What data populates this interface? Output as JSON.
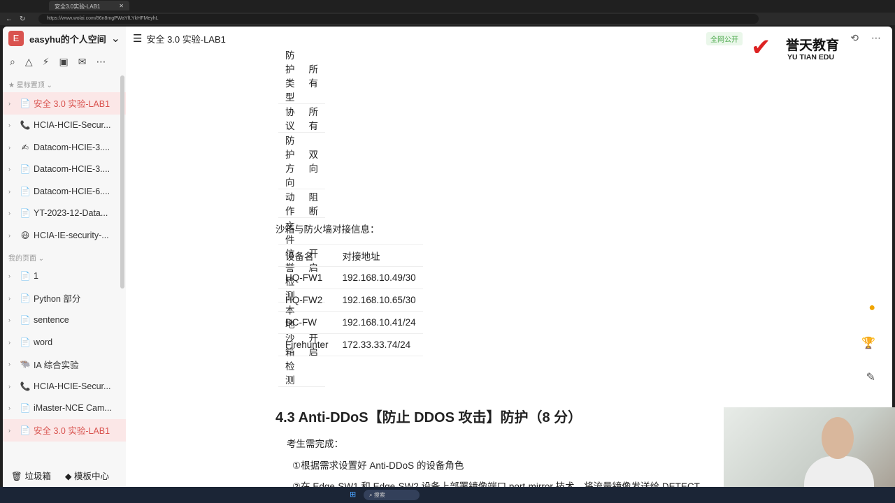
{
  "browser": {
    "tab_title": "安全3.0实验-LAB1",
    "url": "https://www.wolai.com/86n8mgPWaYfLYkHFMeyhL"
  },
  "sidebar": {
    "workspace": "easyhu的个人空间",
    "workspace_initial": "E",
    "starred_label": "星标置顶",
    "my_pages_label": "我的页面",
    "starred": [
      {
        "label": "安全 3.0 实验-LAB1",
        "icon": "📄",
        "active": true
      },
      {
        "label": "HCIA-HCIE-Secur...",
        "icon": "📞"
      },
      {
        "label": "Datacom-HCIE-3....",
        "icon": "✍"
      },
      {
        "label": "Datacom-HCIE-3....",
        "icon": "📄"
      },
      {
        "label": "Datacom-HCIE-6....",
        "icon": "📄"
      },
      {
        "label": "YT-2023-12-Data...",
        "icon": "📄"
      },
      {
        "label": "HCIA-IE-security-...",
        "icon": "😃"
      }
    ],
    "pages": [
      {
        "label": "1",
        "icon": "📄"
      },
      {
        "label": "Python 部分",
        "icon": "📄"
      },
      {
        "label": "sentence",
        "icon": "📄"
      },
      {
        "label": "word",
        "icon": "📄"
      },
      {
        "label": "IA 综合实验",
        "icon": "🐃"
      },
      {
        "label": "HCIA-HCIE-Secur...",
        "icon": "📞"
      },
      {
        "label": "iMaster-NCE Cam...",
        "icon": "📄"
      },
      {
        "label": "安全 3.0 实验-LAB1",
        "icon": "📄",
        "active": true
      }
    ],
    "trash": "垃圾箱",
    "templates": "模板中心"
  },
  "header": {
    "title": "安全 3.0 实验-LAB1",
    "public_badge": "全网公开"
  },
  "logo": {
    "cn": "誉天教育",
    "en": "YU TIAN EDU"
  },
  "table1": [
    [
      "防护类型",
      "所有"
    ],
    [
      "协议",
      "所有"
    ],
    [
      "防护方向",
      "双向"
    ],
    [
      "动作",
      "阻断"
    ],
    [
      "文件信誉检测",
      "开启"
    ],
    [
      "本地沙箱检测",
      "开启"
    ]
  ],
  "sandbox_label": "沙箱与防火墙对接信息：",
  "table2": [
    [
      "设备名",
      "对接地址"
    ],
    [
      "HQ-FW1",
      "192.168.10.49/30"
    ],
    [
      "HQ-FW2",
      "192.168.10.65/30"
    ],
    [
      "DC-FW",
      "192.168.10.41/24"
    ],
    [
      "Firehunter",
      "172.33.33.74/24"
    ]
  ],
  "heading": "4.3 Anti-DDoS【防止 DDOS 攻击】防护（8 分）",
  "candidate": "考生需完成：",
  "step1": "①根据需求设置好 Anti-DDoS 的设备角色",
  "step2": "②在 Edge-SW1 和 Edge-SW2 设备上部署镜像端口 port-mirror 技术，将流量镜像发送给 DETECT",
  "taskbar": {
    "search": "搜索"
  }
}
